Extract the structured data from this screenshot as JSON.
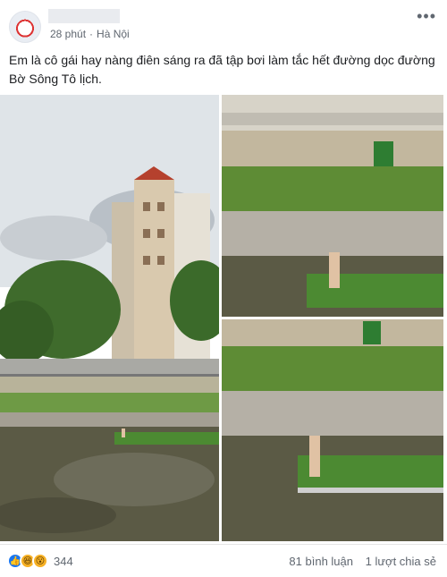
{
  "post": {
    "time": "28 phút",
    "separator": "·",
    "location": "Hà Nội",
    "more_label": "•••",
    "text": "Em là cô gái hay nàng điên sáng ra đã tập bơi làm tắc hết đường dọc đường Bờ Sông Tô lịch."
  },
  "footer": {
    "reaction_count": "344",
    "comments": "81 bình luận",
    "shares": "1 lượt chia sẻ"
  },
  "reactions": [
    "like-icon",
    "haha-icon",
    "wow-icon"
  ],
  "colors": {
    "like": "#1877f2",
    "emoji": "#f7b125",
    "meta_text": "#606770",
    "water": "#5b5a45",
    "grass": "#4c8a32"
  }
}
